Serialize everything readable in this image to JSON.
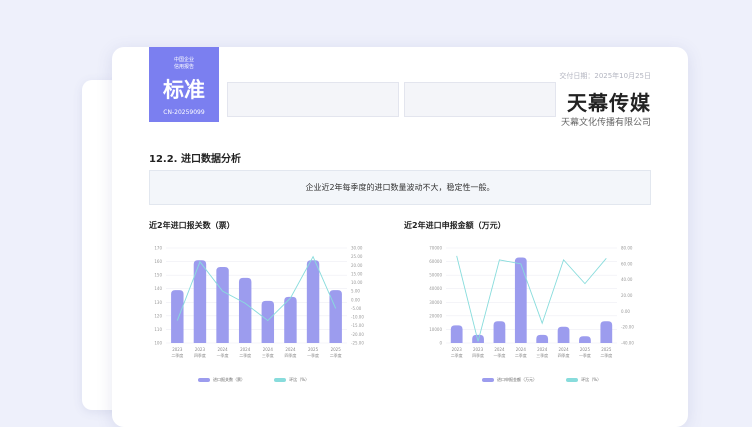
{
  "badge": {
    "line1": "中国企业",
    "line2": "信用报告",
    "grade": "标准",
    "code": "CN-20259099"
  },
  "delivery": "交付日期：2025年10月25日",
  "brand": "天幕传媒",
  "company": "天幕文化传播有限公司",
  "section_title": "12.2. 进口数据分析",
  "summary": "企业近2年每季度的进口数量波动不大，稳定性一般。",
  "colors": {
    "accent": "#7b7ff0",
    "bar": "#9c9cee",
    "line": "#88dcdc"
  },
  "chart_data": [
    {
      "type": "bar",
      "title": "近2年进口报关数（票）",
      "categories": [
        "2023 二季度",
        "2023 四季度",
        "2024 一季度",
        "2024 二季度",
        "2024 三季度",
        "2024 四季度",
        "2025 一季度",
        "2025 二季度"
      ],
      "tick_labels": [
        [
          "2023",
          "二季度"
        ],
        [
          "2023",
          "四季度"
        ],
        [
          "2024",
          "一季度"
        ],
        [
          "2024",
          "二季度"
        ],
        [
          "2024",
          "三季度"
        ],
        [
          "2024",
          "四季度"
        ],
        [
          "2025",
          "一季度"
        ],
        [
          "2025",
          "二季度"
        ]
      ],
      "ylim": [
        100,
        170
      ],
      "y_ticks": [
        "170",
        "160",
        "150",
        "140",
        "130",
        "120",
        "110",
        "100"
      ],
      "y2lim": [
        -25,
        30
      ],
      "y2_ticks": [
        "30.00",
        "25.00",
        "20.00",
        "15.00",
        "10.00",
        "5.00",
        "0.00",
        "-5.00",
        "-10.00",
        "-15.00",
        "-20.00",
        "-25.00"
      ],
      "series": [
        {
          "name": "进口报关数（票）",
          "kind": "bar",
          "values": [
            139,
            161,
            156,
            148,
            131,
            134,
            161,
            139
          ]
        },
        {
          "name": "环比（%）",
          "kind": "line",
          "axis": "right",
          "values": [
            -12,
            22,
            5,
            -2,
            -12,
            1,
            25,
            -5
          ]
        }
      ],
      "legend_position": "bottom"
    },
    {
      "type": "bar",
      "title": "近2年进口申报金额（万元）",
      "categories": [
        "2023 二季度",
        "2023 四季度",
        "2024 一季度",
        "2024 二季度",
        "2024 三季度",
        "2024 四季度",
        "2025 一季度",
        "2025 二季度"
      ],
      "tick_labels": [
        [
          "2023",
          "二季度"
        ],
        [
          "2023",
          "四季度"
        ],
        [
          "2024",
          "一季度"
        ],
        [
          "2024",
          "二季度"
        ],
        [
          "2024",
          "三季度"
        ],
        [
          "2024",
          "四季度"
        ],
        [
          "2025",
          "一季度"
        ],
        [
          "2025",
          "二季度"
        ]
      ],
      "ylim": [
        0,
        70000
      ],
      "y_ticks": [
        "70000",
        "60000",
        "50000",
        "40000",
        "30000",
        "20000",
        "10000",
        "0"
      ],
      "y2lim": [
        -40,
        80
      ],
      "y2_ticks": [
        "80.00",
        "60.00",
        "40.00",
        "20.00",
        "0.00",
        "-20.00",
        "-40.00"
      ],
      "series": [
        {
          "name": "进口申报金额（万元）",
          "kind": "bar",
          "values": [
            13000,
            6000,
            16000,
            63000,
            6000,
            12000,
            5000,
            16000
          ]
        },
        {
          "name": "环比（%）",
          "kind": "line",
          "axis": "right",
          "values": [
            70,
            -38,
            65,
            60,
            -15,
            65,
            35,
            67
          ]
        }
      ],
      "legend_position": "bottom"
    }
  ]
}
